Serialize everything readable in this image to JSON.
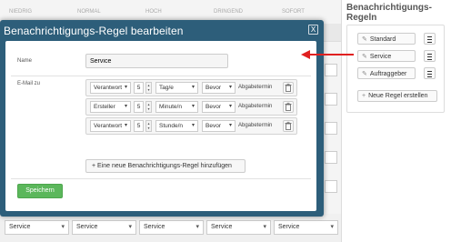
{
  "background": {
    "columns": [
      "Niedrig",
      "Normal",
      "Hoch",
      "Dringend",
      "Sofort"
    ],
    "row_cells": [
      "Service",
      "Service",
      "Service",
      "Service",
      "Service"
    ]
  },
  "right_panel": {
    "title": "Benachrichtigungs-Regeln",
    "buttons": [
      {
        "label": "Standard",
        "icon": "edit-icon"
      },
      {
        "label": "Service",
        "icon": "edit-icon"
      },
      {
        "label": "Auftraggeber",
        "icon": "edit-icon"
      }
    ],
    "new_rule": "Neue Regel erstellen"
  },
  "modal": {
    "title": "Benachrichtigungs-Regel bearbeiten",
    "close": "X",
    "name_label": "Name",
    "name_value": "Service",
    "email_label": "E-Mail zu",
    "rules": [
      {
        "recipient": "Verantwort",
        "amount": "5",
        "unit": "Tag/e",
        "timing": "Bevor",
        "ref": "Abgabetermin"
      },
      {
        "recipient": "Ersteller",
        "amount": "5",
        "unit": "Minute/n",
        "timing": "Bevor",
        "ref": "Abgabetermin"
      },
      {
        "recipient": "Verantwort",
        "amount": "5",
        "unit": "Stunde/n",
        "timing": "Bevor",
        "ref": "Abgabetermin"
      }
    ],
    "add_rule_label": "Eine neue Benachrichtigungs-Regel hinzufügen",
    "save_label": "Speichern"
  },
  "colors": {
    "modal_header": "#2d5e7a",
    "save_button": "#5bb75b",
    "arrow": "#e02020"
  }
}
